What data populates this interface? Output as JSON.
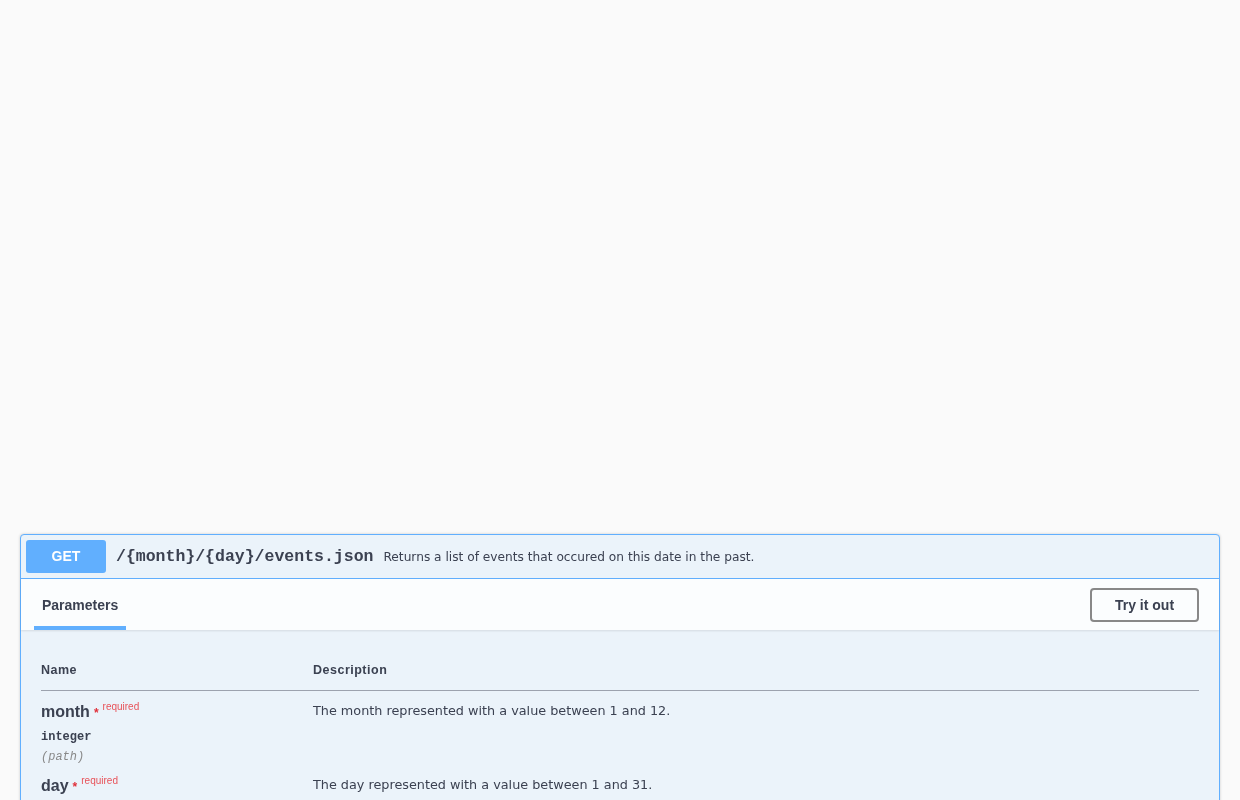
{
  "operation": {
    "method": "GET",
    "path": "/{month}/{day}/events.json",
    "summary": "Returns a list of events that occured on this date in the past."
  },
  "tabs": [
    {
      "label": "Parameters",
      "selected": true
    }
  ],
  "try_button": "Try it out",
  "table": {
    "columns": [
      "Name",
      "Description"
    ],
    "rows": [
      {
        "name": "month",
        "required": true,
        "required_mark": "*",
        "required_label": "required",
        "type": "integer",
        "location": "(path)",
        "description": "The month represented with a value between 1 and 12."
      },
      {
        "name": "day",
        "required": true,
        "required_mark": "*",
        "required_label": "required",
        "description": "The day represented with a value between 1 and 31."
      }
    ]
  }
}
